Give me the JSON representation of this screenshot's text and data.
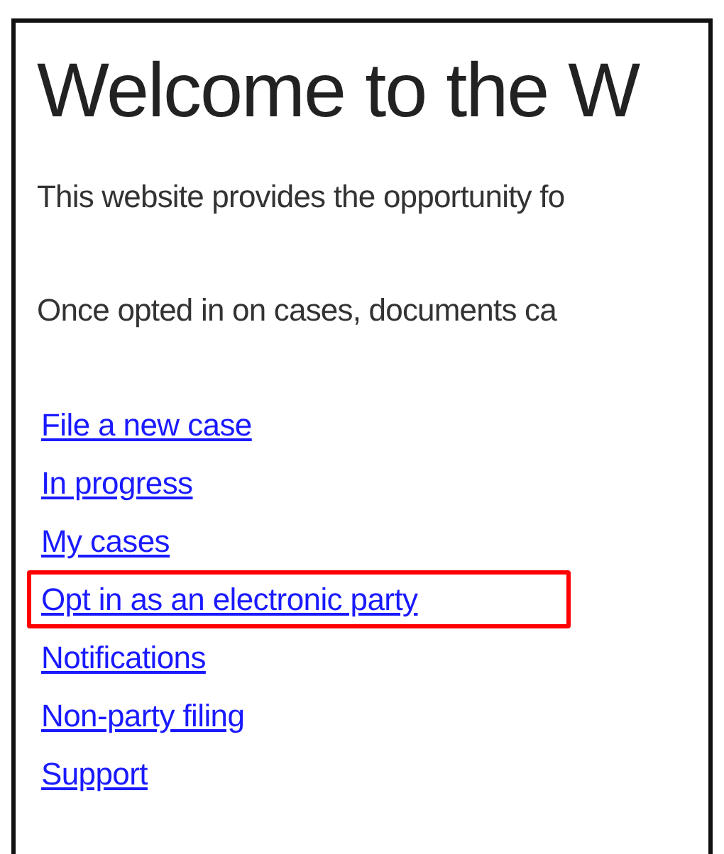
{
  "heading": "Welcome to the W",
  "paragraphs": [
    "This website provides the opportunity fo",
    "Once opted in on cases, documents ca"
  ],
  "links": [
    {
      "label": "File a new case",
      "highlighted": false
    },
    {
      "label": "In progress",
      "highlighted": false
    },
    {
      "label": "My cases",
      "highlighted": false
    },
    {
      "label": "Opt in as an electronic party",
      "highlighted": true
    },
    {
      "label": "Notifications",
      "highlighted": false
    },
    {
      "label": "Non-party filing",
      "highlighted": false
    },
    {
      "label": "Support",
      "highlighted": false
    }
  ]
}
